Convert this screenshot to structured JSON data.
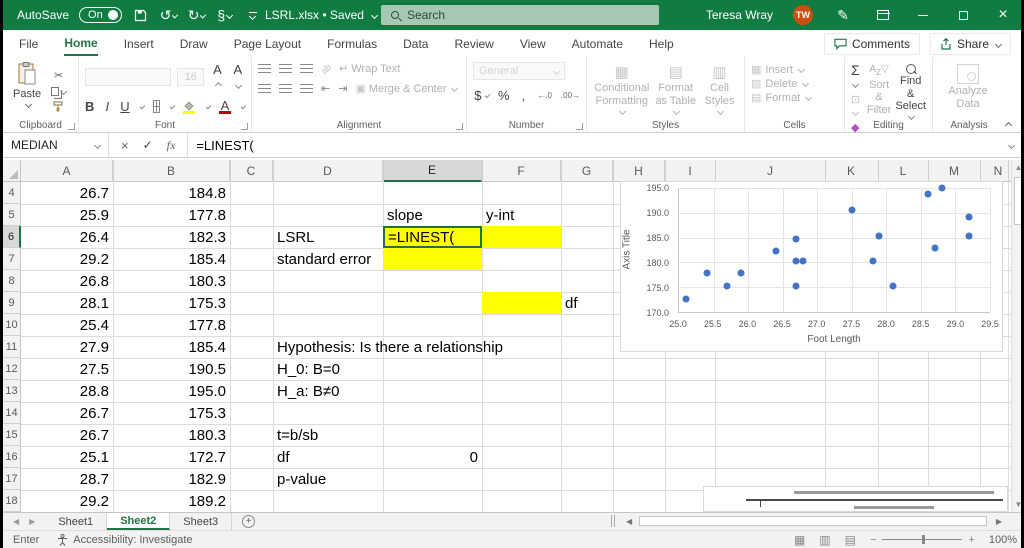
{
  "titlebar": {
    "autosave_label": "AutoSave",
    "autosave_state": "On",
    "doc_title": "LSRL.xlsx • Saved",
    "search_placeholder": "Search",
    "user_name": "Teresa Wray",
    "user_initials": "TW"
  },
  "ribbon": {
    "tabs": [
      "File",
      "Home",
      "Insert",
      "Draw",
      "Page Layout",
      "Formulas",
      "Data",
      "Review",
      "View",
      "Automate",
      "Help"
    ],
    "active_tab": "Home",
    "comments_label": "Comments",
    "share_label": "Share",
    "clipboard": {
      "label": "Clipboard",
      "paste": "Paste"
    },
    "font": {
      "label": "Font",
      "size": "16"
    },
    "alignment": {
      "label": "Alignment",
      "wrap": "Wrap Text",
      "merge": "Merge & Center"
    },
    "number": {
      "label": "Number",
      "format": "General"
    },
    "styles": {
      "label": "Styles",
      "conditional": "Conditional Formatting",
      "format_table": "Format as Table",
      "cell_styles": "Cell Styles"
    },
    "cells": {
      "label": "Cells",
      "insert": "Insert",
      "delete": "Delete",
      "format": "Format"
    },
    "editing": {
      "label": "Editing",
      "sort": "Sort & Filter",
      "find": "Find & Select"
    },
    "analysis": {
      "label": "Analysis",
      "analyze": "Analyze Data"
    }
  },
  "formula_bar": {
    "name_box": "MEDIAN",
    "formula": "=LINEST("
  },
  "grid": {
    "columns": [
      "A",
      "B",
      "C",
      "D",
      "E",
      "F",
      "G",
      "H",
      "I",
      "J",
      "K",
      "L",
      "M",
      "N"
    ],
    "selected_column": "E",
    "selected_row": "6",
    "active_cell": "E6",
    "yellow_cells": [
      "E6",
      "F6",
      "E7",
      "F9"
    ],
    "rows": [
      {
        "n": "4",
        "A": "26.7",
        "B": "184.8"
      },
      {
        "n": "5",
        "A": "25.9",
        "B": "177.8",
        "E": "slope",
        "F": "y-int"
      },
      {
        "n": "6",
        "A": "26.4",
        "B": "182.3",
        "D": "LSRL",
        "E": "=LINEST("
      },
      {
        "n": "7",
        "A": "29.2",
        "B": "185.4",
        "D": "standard error"
      },
      {
        "n": "8",
        "A": "26.8",
        "B": "180.3"
      },
      {
        "n": "9",
        "A": "28.1",
        "B": "175.3",
        "G": "df"
      },
      {
        "n": "10",
        "A": "25.4",
        "B": "177.8"
      },
      {
        "n": "11",
        "A": "27.9",
        "B": "185.4",
        "D": "Hypothesis: Is there a relationship"
      },
      {
        "n": "12",
        "A": "27.5",
        "B": "190.5",
        "D": "H_0: B=0"
      },
      {
        "n": "13",
        "A": "28.8",
        "B": "195.0",
        "D": "H_a: B≠0"
      },
      {
        "n": "14",
        "A": "26.7",
        "B": "175.3"
      },
      {
        "n": "15",
        "A": "26.7",
        "B": "180.3",
        "D": "t=b/sb"
      },
      {
        "n": "16",
        "A": "25.1",
        "B": "172.7",
        "D": "df",
        "E": "0"
      },
      {
        "n": "17",
        "A": "28.7",
        "B": "182.9",
        "D": "p-value"
      },
      {
        "n": "18",
        "A": "29.2",
        "B": "189.2"
      }
    ]
  },
  "chart_data": {
    "type": "scatter",
    "title": "",
    "xlabel": "Foot Length",
    "ylabel": "Axis Title",
    "xlim": [
      25.0,
      29.5
    ],
    "ylim": [
      170.0,
      195.0
    ],
    "x_ticks": [
      25.0,
      25.5,
      26.0,
      26.5,
      27.0,
      27.5,
      28.0,
      28.5,
      29.0,
      29.5
    ],
    "y_ticks": [
      170.0,
      175.0,
      180.0,
      185.0,
      190.0,
      195.0
    ],
    "grid": true,
    "legend": false,
    "point_color": "#4472C4",
    "points": [
      [
        25.1,
        172.7
      ],
      [
        25.4,
        177.8
      ],
      [
        25.7,
        175.3
      ],
      [
        25.9,
        177.8
      ],
      [
        26.4,
        182.3
      ],
      [
        26.7,
        175.3
      ],
      [
        26.7,
        180.3
      ],
      [
        26.7,
        184.8
      ],
      [
        26.8,
        180.3
      ],
      [
        27.5,
        190.5
      ],
      [
        27.8,
        180.3
      ],
      [
        27.9,
        185.4
      ],
      [
        28.1,
        175.3
      ],
      [
        28.6,
        193.8
      ],
      [
        28.7,
        182.9
      ],
      [
        28.8,
        195.0
      ],
      [
        29.2,
        185.4
      ],
      [
        29.2,
        189.2
      ]
    ]
  },
  "sheet_tabs": {
    "tabs": [
      "Sheet1",
      "Sheet2",
      "Sheet3"
    ],
    "active": "Sheet2"
  },
  "status_bar": {
    "mode": "Enter",
    "accessibility": "Accessibility: Investigate",
    "zoom_level": "100%"
  },
  "colors": {
    "accent_green": "#107C41",
    "selection_green": "#217346",
    "highlight_yellow": "#FFFF00",
    "point_blue": "#4472C4",
    "avatar_orange": "#CA5010"
  }
}
